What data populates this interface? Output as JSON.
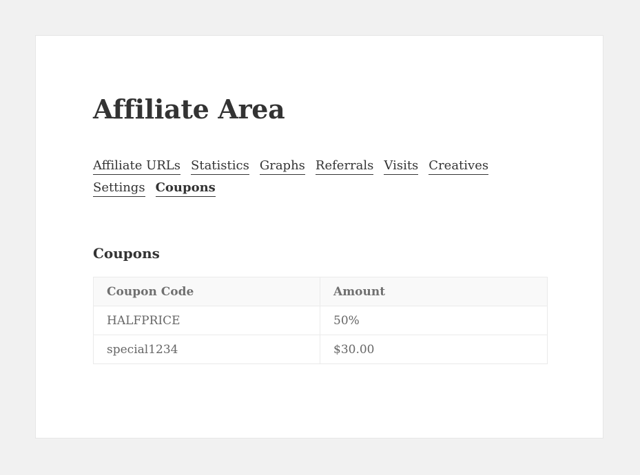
{
  "page": {
    "title": "Affiliate Area"
  },
  "tabs": [
    {
      "label": "Affiliate URLs",
      "active": false
    },
    {
      "label": "Statistics",
      "active": false
    },
    {
      "label": "Graphs",
      "active": false
    },
    {
      "label": "Referrals",
      "active": false
    },
    {
      "label": "Visits",
      "active": false
    },
    {
      "label": "Creatives",
      "active": false
    },
    {
      "label": "Settings",
      "active": false
    },
    {
      "label": "Coupons",
      "active": true
    }
  ],
  "coupons_section": {
    "title": "Coupons",
    "columns": [
      "Coupon Code",
      "Amount"
    ],
    "rows": [
      {
        "code": "HALFPRICE",
        "amount": "50%"
      },
      {
        "code": "special1234",
        "amount": "$30.00"
      }
    ]
  },
  "colors": {
    "background": "#f1f1f1",
    "card": "#ffffff",
    "text": "#333333",
    "table_text": "#666666",
    "table_header_bg": "#f9f9f9",
    "table_border": "#eaeaea"
  }
}
